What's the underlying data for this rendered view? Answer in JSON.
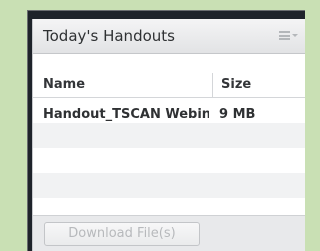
{
  "pod": {
    "title": "Today's Handouts",
    "menu_icon": "hamburger-menu-icon"
  },
  "table": {
    "columns": [
      "Name",
      "Size"
    ],
    "rows": [
      {
        "name": "Handout_TSCAN Webinar",
        "size": "9 MB"
      }
    ]
  },
  "footer": {
    "download_label": "Download File(s)"
  },
  "colors": {
    "background": "#c9e0b4",
    "frame": "#1e232a",
    "header": "#e2e3e5",
    "alt_row": "#f1f2f3"
  }
}
